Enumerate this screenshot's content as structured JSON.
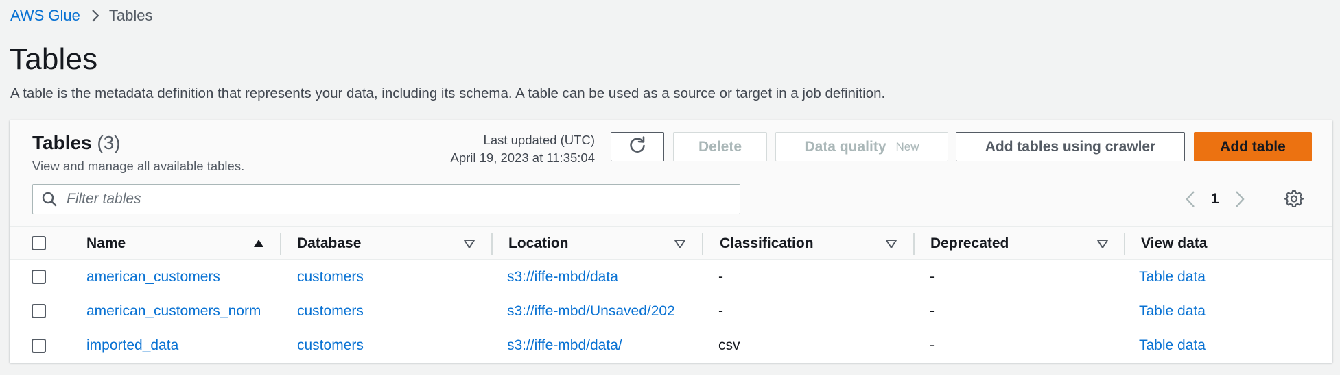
{
  "breadcrumb": {
    "root": "AWS Glue",
    "current": "Tables"
  },
  "page": {
    "title": "Tables",
    "description": "A table is the metadata definition that represents your data, including its schema. A table can be used as a source or target in a job definition."
  },
  "panel": {
    "title": "Tables",
    "count": "(3)",
    "subtitle": "View and manage all available tables.",
    "last_updated_label": "Last updated (UTC)",
    "last_updated_value": "April 19, 2023 at 11:35:04",
    "buttons": {
      "refresh_icon": "refresh-icon",
      "delete": "Delete",
      "data_quality": "Data quality",
      "data_quality_badge": "New",
      "add_crawler": "Add tables using crawler",
      "add_table": "Add table"
    },
    "filter": {
      "placeholder": "Filter tables",
      "value": ""
    },
    "pagination": {
      "current_page": "1"
    }
  },
  "table": {
    "columns": [
      "Name",
      "Database",
      "Location",
      "Classification",
      "Deprecated",
      "View data"
    ],
    "rows": [
      {
        "name": "american_customers",
        "database": "customers",
        "location": "s3://iffe-mbd/data",
        "classification": "-",
        "deprecated": "-",
        "view": "Table data"
      },
      {
        "name": "american_customers_norm",
        "database": "customers",
        "location": "s3://iffe-mbd/Unsaved/202",
        "classification": "-",
        "deprecated": "-",
        "view": "Table data"
      },
      {
        "name": "imported_data",
        "database": "customers",
        "location": "s3://iffe-mbd/data/",
        "classification": "csv",
        "deprecated": "-",
        "view": "Table data"
      }
    ]
  },
  "colors": {
    "link": "#0972d3",
    "primary_button": "#ec7211",
    "background": "#f2f3f3"
  }
}
